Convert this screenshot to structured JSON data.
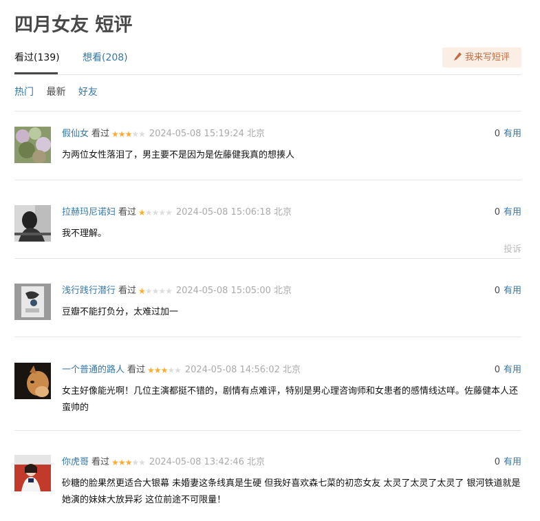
{
  "page_title": "四月女友 短评",
  "tabs": {
    "seen": "看过(139)",
    "want": "想看(208)"
  },
  "write_button": "我来写短评",
  "filters": {
    "hot": "热门",
    "latest": "最新",
    "friends": "好友"
  },
  "comments": [
    {
      "user": "假仙女",
      "status": "看过",
      "rating": 3,
      "time": "2024-05-08 15:19:24 北京",
      "useful_count": "0",
      "useful_label": "有用",
      "text": "为两位女性落泪了，男主要不是因为是佐藤健我真的想揍人"
    },
    {
      "user": "拉赫玛尼诺妇",
      "status": "看过",
      "rating": 1,
      "time": "2024-05-08 15:06:18 北京",
      "useful_count": "0",
      "useful_label": "有用",
      "text": "我不理解。",
      "report": "投诉"
    },
    {
      "user": "浅行践行潜行",
      "status": "看过",
      "rating": 1,
      "time": "2024-05-08 15:05:00 北京",
      "useful_count": "0",
      "useful_label": "有用",
      "text": "豆瓣不能打负分，太难过加一"
    },
    {
      "user": "一个普通的路人",
      "status": "看过",
      "rating": 3,
      "time": "2024-05-08 14:56:02 北京",
      "useful_count": "0",
      "useful_label": "有用",
      "text": "女主好像能光啊！几位主演都挺不错的，剧情有点难评，特别是男心理咨询师和女患者的感情线达咩。佐藤健本人还蛮帅的"
    },
    {
      "user": "你虎哥",
      "status": "看过",
      "rating": 3,
      "time": "2024-05-08 13:42:46 北京",
      "useful_count": "0",
      "useful_label": "有用",
      "text": "砂糖的脸果然更适合大银幕 未婚妻这条线真是生硬 但我好喜欢森七菜的初恋女友 太灵了太灵了太灵了 银河铁道就是她演的妹妹大放异彩 这位前途不可限量！"
    }
  ],
  "colors": {
    "link": "#3377aa",
    "star": "#ffac2d",
    "write_bg": "#fbeee4",
    "write_text": "#c26b42"
  }
}
